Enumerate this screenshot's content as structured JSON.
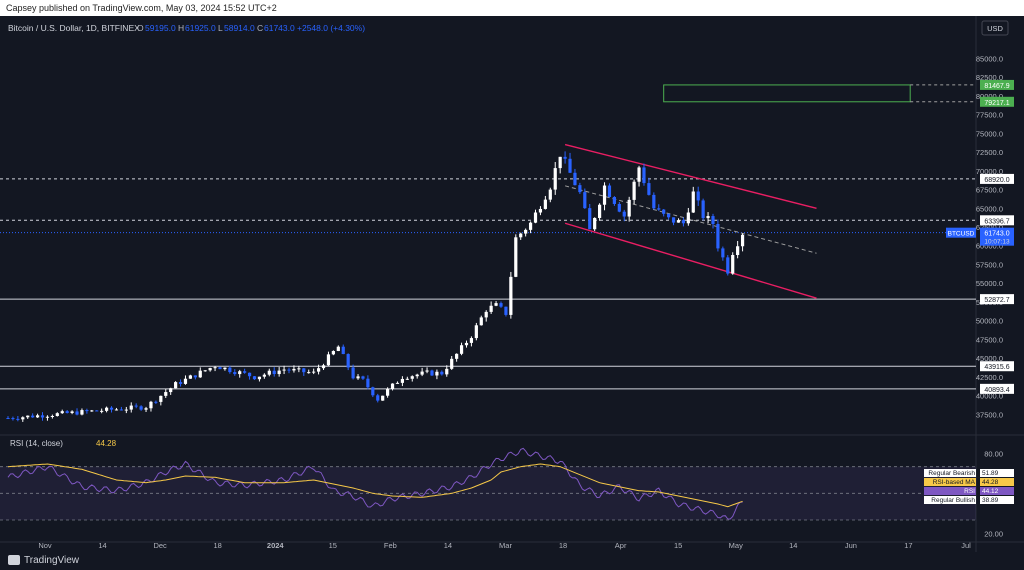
{
  "publisher_line": "Capsey published on TradingView.com, May 03, 2024 15:52 UTC+2",
  "symbol": {
    "title": "Bitcoin / U.S. Dollar, 1D, BITFINEX",
    "o_label": "O",
    "o": "59195.0",
    "h_label": "H",
    "h": "61925.0",
    "l_label": "L",
    "l": "58914.0",
    "c_label": "C",
    "c": "61743.0",
    "change": "+2548.0 (+4.30%)"
  },
  "currency": "USD",
  "brand": "TradingView",
  "colors": {
    "background": "#131722",
    "up": "#ffffff",
    "down": "#2962ff",
    "channel": "#e91e63",
    "rsi_line": "#7e57c2",
    "rsi_ma": "#f7c948",
    "zone": "#4caf50"
  },
  "chart_data": [
    {
      "type": "candlestick",
      "title": "Bitcoin / U.S. Dollar, 1D, BITFINEX",
      "ylim": [
        35000,
        88000
      ],
      "y_ticks": [
        "85000.0",
        "82500.0",
        "80000.0",
        "77500.0",
        "75000.0",
        "72500.0",
        "70000.0",
        "67500.0",
        "65000.0",
        "62500.0",
        "60000.0",
        "57500.0",
        "55000.0",
        "52500.0",
        "50000.0",
        "47500.0",
        "45000.0",
        "42500.0",
        "40000.0",
        "37500.0"
      ],
      "x_ticks": [
        "Nov",
        "14",
        "Dec",
        "18",
        "2024",
        "15",
        "Feb",
        "14",
        "Mar",
        "18",
        "Apr",
        "15",
        "May",
        "14",
        "Jun",
        "17",
        "Jul"
      ],
      "x_ticks_bold": [
        "2024"
      ],
      "candle_keypoints_t": [
        0,
        15,
        28,
        34,
        42,
        50,
        56,
        62,
        67,
        70,
        72,
        75,
        80,
        85,
        88,
        94,
        97,
        99,
        101,
        103,
        106,
        110,
        112,
        116,
        118,
        121,
        125,
        128,
        131,
        134,
        137,
        139,
        141,
        143,
        144,
        146,
        147,
        149
      ],
      "candle_keypoints_price": [
        37000,
        37800,
        38500,
        41500,
        44000,
        42500,
        43500,
        43000,
        46500,
        42500,
        42000,
        39500,
        42500,
        43000,
        43000,
        48000,
        51500,
        52000,
        51000,
        61000,
        63000,
        68000,
        72300,
        67000,
        62000,
        68000,
        64000,
        70500,
        65000,
        63500,
        63000,
        67000,
        64000,
        63000,
        60000,
        56700,
        59200,
        61743
      ],
      "levels": [
        {
          "value": 81467.9,
          "label": "81467.9",
          "style": "zone"
        },
        {
          "value": 79217.1,
          "label": "79217.1",
          "style": "zone"
        },
        {
          "value": 68920.0,
          "label": "68920.0",
          "style": "dashed"
        },
        {
          "value": 63396.7,
          "label": "63396.7",
          "style": "dashed"
        },
        {
          "value": 61743.0,
          "label": "61743.0",
          "style": "current"
        },
        {
          "value": 52872.7,
          "label": "52872.7",
          "style": "solid"
        },
        {
          "value": 43915.6,
          "label": "43915.6",
          "style": "solid"
        },
        {
          "value": 40893.4,
          "label": "40893.4",
          "style": "solid"
        }
      ],
      "price_tag": {
        "symbol": "BTCUSD",
        "value": "61743.0",
        "countdown": "10:07:13"
      },
      "channel_upper": [
        [
          113,
          73500
        ],
        [
          164,
          65000
        ]
      ],
      "channel_lower": [
        [
          113,
          63000
        ],
        [
          164,
          53000
        ]
      ],
      "channel_mid": [
        [
          113,
          68000
        ],
        [
          164,
          59000
        ]
      ],
      "zone": {
        "t0": 133,
        "t1": 183,
        "top": 81467.9,
        "bottom": 79217.1
      }
    },
    {
      "type": "line",
      "title": "RSI (14, close)",
      "value_shown": "44.28",
      "ylim": [
        15,
        90
      ],
      "y_ticks": [
        "80.00",
        "20.00"
      ],
      "bands": [
        70,
        50,
        30
      ],
      "legend": [
        {
          "name": "Regular Bearish",
          "value": "51.89"
        },
        {
          "name": "RSI-based MA",
          "value": "44.28"
        },
        {
          "name": "RSI",
          "value": "44.12"
        },
        {
          "name": "Regular Bullish",
          "value": "38.89"
        }
      ],
      "rsi_keypoints_t": [
        0,
        8,
        15,
        22,
        28,
        32,
        36,
        42,
        48,
        56,
        62,
        66,
        70,
        74,
        78,
        84,
        90,
        94,
        98,
        100,
        104,
        108,
        112,
        116,
        120,
        124,
        128,
        132,
        136,
        140,
        144,
        146,
        149
      ],
      "rsi_keypoints": [
        62,
        70,
        55,
        52,
        58,
        66,
        72,
        58,
        56,
        60,
        70,
        52,
        48,
        40,
        46,
        50,
        55,
        62,
        72,
        76,
        82,
        78,
        74,
        56,
        48,
        55,
        46,
        52,
        42,
        38,
        34,
        30,
        44
      ],
      "ma_keypoints": [
        70,
        72,
        68,
        60,
        58,
        60,
        63,
        62,
        58,
        58,
        60,
        57,
        54,
        50,
        48,
        47,
        50,
        54,
        60,
        66,
        70,
        72,
        70,
        64,
        58,
        55,
        52,
        51,
        48,
        45,
        42,
        40,
        44
      ]
    }
  ]
}
